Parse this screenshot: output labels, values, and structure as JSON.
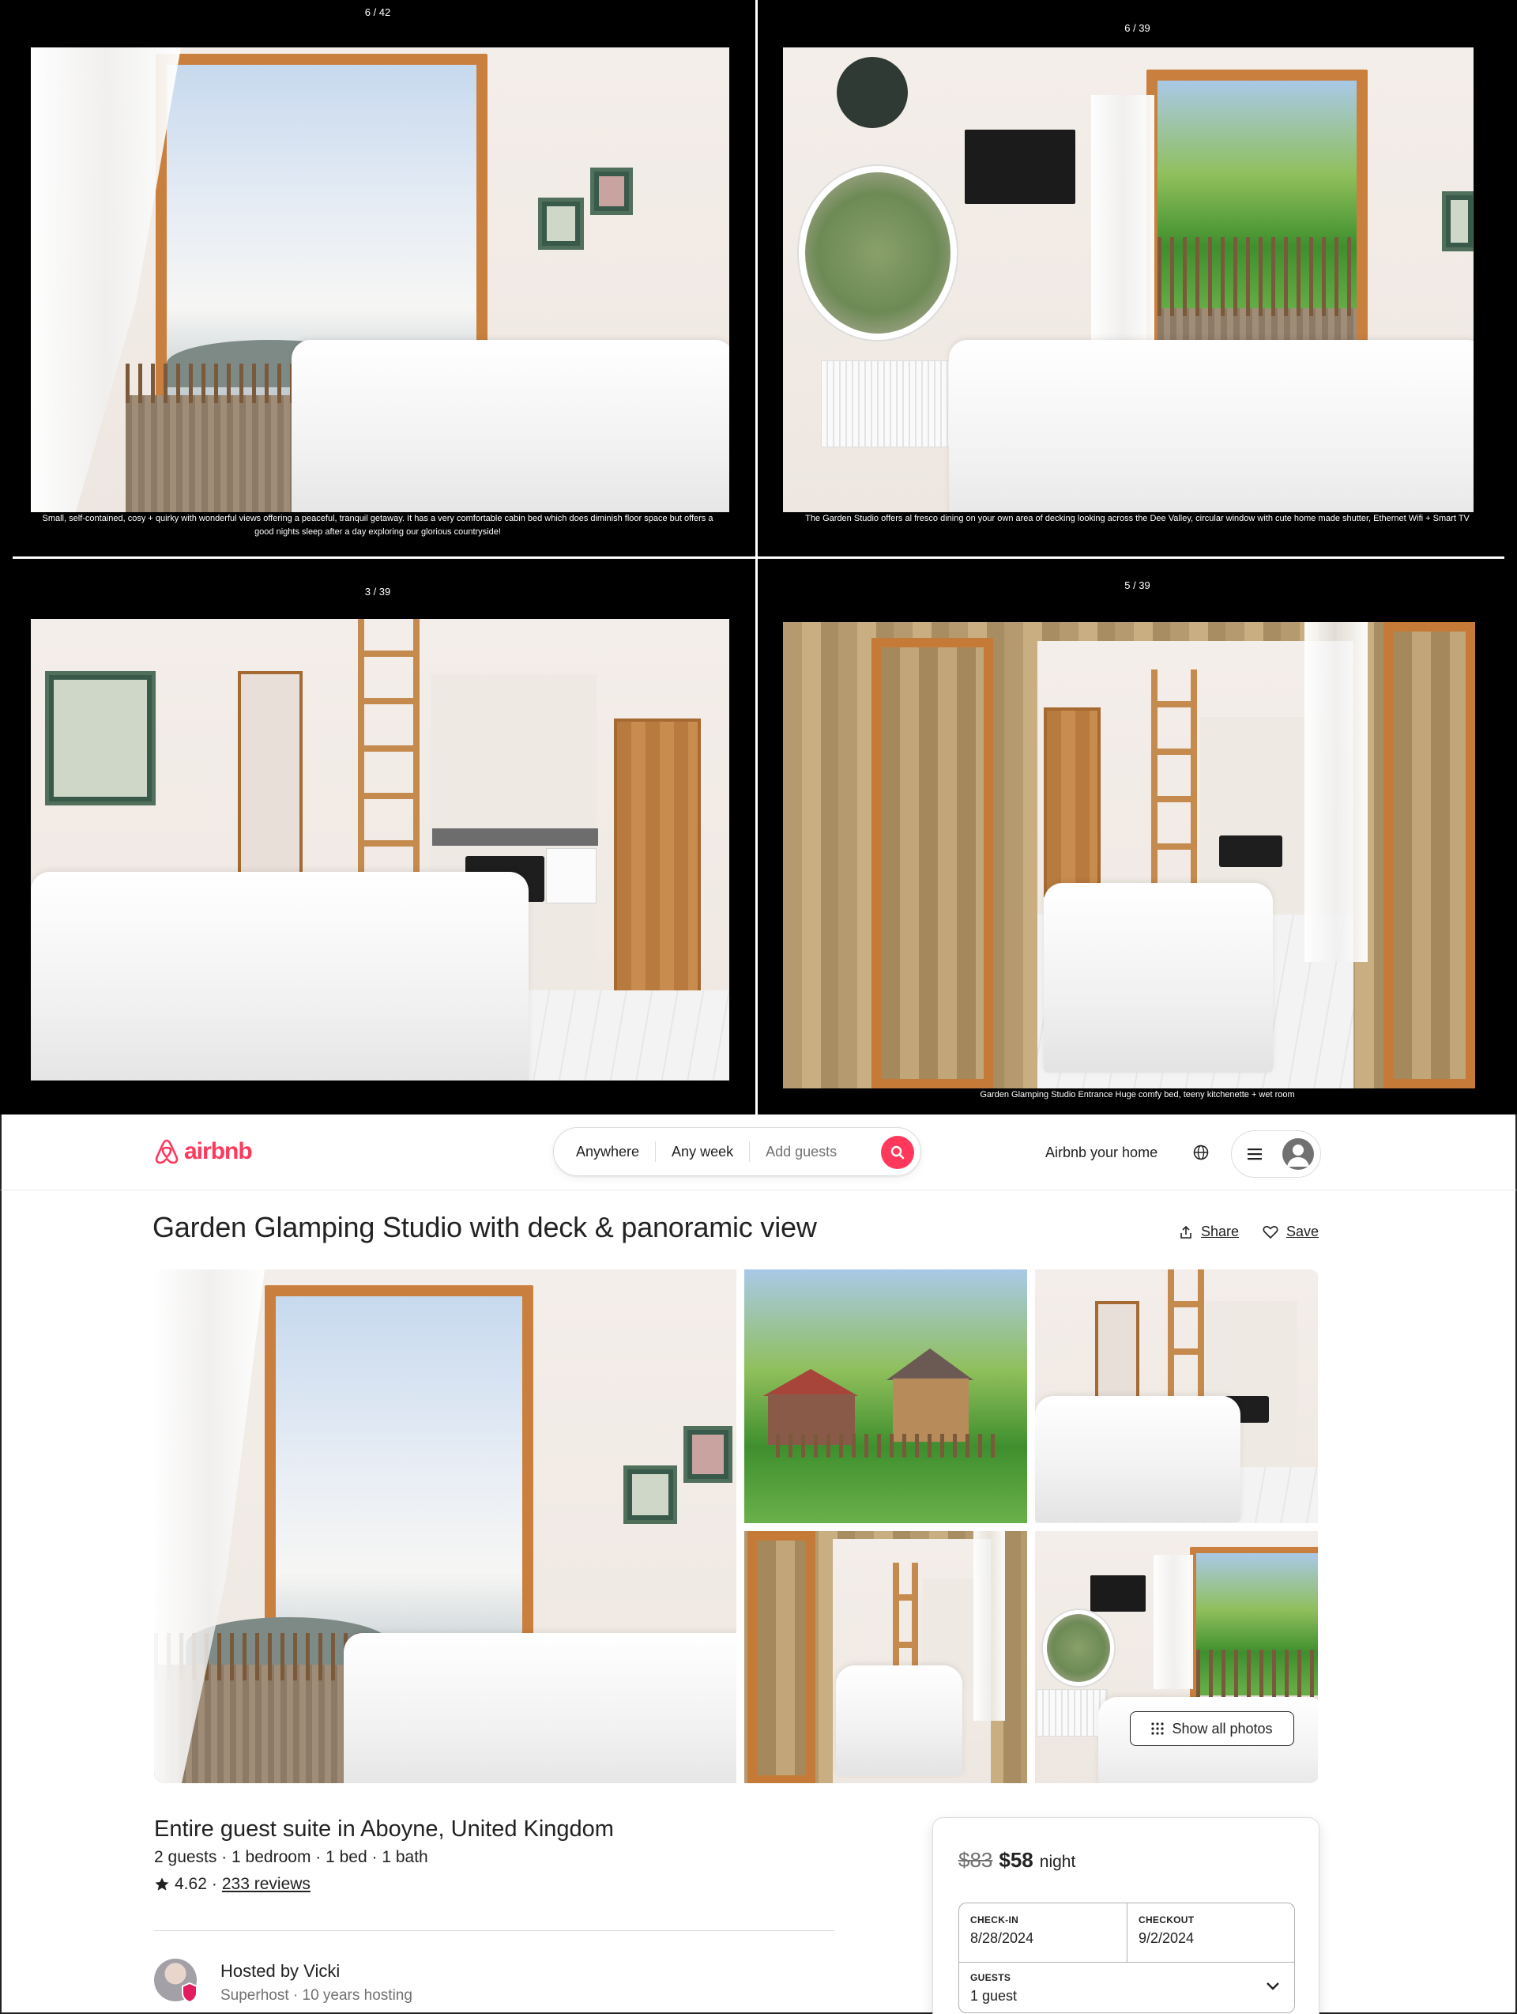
{
  "lightbox": {
    "panels": [
      {
        "counter": "6 / 42",
        "caption": "Small, self-contained, cosy + quirky with wonderful views offering a peaceful, tranquil getaway. It has a very comfortable cabin bed which does diminish floor space but offers a good nights sleep after a day exploring our glorious countryside!"
      },
      {
        "counter": "6 / 39",
        "caption": "The Garden Studio offers al fresco dining on your own area of decking looking across the Dee Valley, circular window with cute home made shutter, Ethernet Wifi + Smart TV"
      },
      {
        "counter": "3 / 39",
        "caption": ""
      },
      {
        "counter": "5 / 39",
        "caption": "Garden Glamping Studio Entrance Huge comfy bed, teeny kitchenette + wet room"
      }
    ]
  },
  "header": {
    "logo_text": "airbnb",
    "search": {
      "where": "Anywhere",
      "when": "Any week",
      "guests_placeholder": "Add guests"
    },
    "host_link": "Airbnb your home"
  },
  "listing": {
    "title": "Garden Glamping Studio with deck & panoramic view",
    "share_label": "Share",
    "save_label": "Save",
    "show_all_photos": "Show all photos",
    "subtitle": "Entire guest suite in Aboyne, United Kingdom",
    "specs": "2 guests · 1 bedroom · 1 bed · 1 bath",
    "rating": "4.62",
    "rating_sep": "·",
    "reviews": "233 reviews",
    "host": {
      "name_line": "Hosted by Vicki",
      "meta": "Superhost · 10 years hosting"
    }
  },
  "booking": {
    "old_price": "$83",
    "new_price": "$58",
    "unit": "night",
    "checkin_label": "CHECK-IN",
    "checkin_value": "8/28/2024",
    "checkout_label": "CHECKOUT",
    "checkout_value": "9/2/2024",
    "guests_label": "GUESTS",
    "guests_value": "1 guest"
  },
  "colors": {
    "brand": "#ff385c",
    "text": "#222222",
    "muted": "#717171"
  }
}
